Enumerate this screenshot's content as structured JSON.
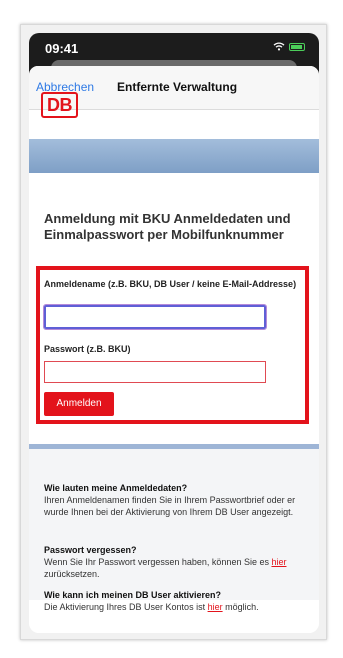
{
  "status_bar": {
    "time": "09:41"
  },
  "nav": {
    "cancel_label": "Abbrechen",
    "title": "Entfernte Verwaltung"
  },
  "logo": {
    "text": "DB"
  },
  "login": {
    "heading": "Anmeldung mit BKU Anmeldedaten und Einmalpasswort per Mobilfunknummer",
    "username_label": "Anmeldename (z.B. BKU, DB User / keine E-Mail-Addresse)",
    "username_value": "",
    "password_label": "Passwort (z.B. BKU)",
    "password_value": "",
    "submit_label": "Anmelden"
  },
  "faq": {
    "q1": "Wie lauten meine Anmeldedaten?",
    "a1": "Ihren Anmeldenamen finden Sie in Ihrem Passwortbrief oder er wurde Ihnen bei der Aktivierung von Ihrem DB User angezeigt.",
    "q2": "Passwort vergessen?",
    "a2_before": "Wenn Sie Ihr Passwort vergessen haben, können Sie es ",
    "a2_link": "hier",
    "a2_after": " zurücksetzen.",
    "q3": "Wie kann ich meinen DB User aktivieren?",
    "a3_before": "Die Aktivierung Ihres DB User Kontos ist ",
    "a3_link": "hier",
    "a3_after": " möglich."
  },
  "colors": {
    "brand_red": "#e3131b",
    "link_blue": "#2f7ae5",
    "band_blue": "#8eaad0"
  },
  "icons": {
    "wifi": "wifi-icon",
    "battery": "battery-icon"
  }
}
